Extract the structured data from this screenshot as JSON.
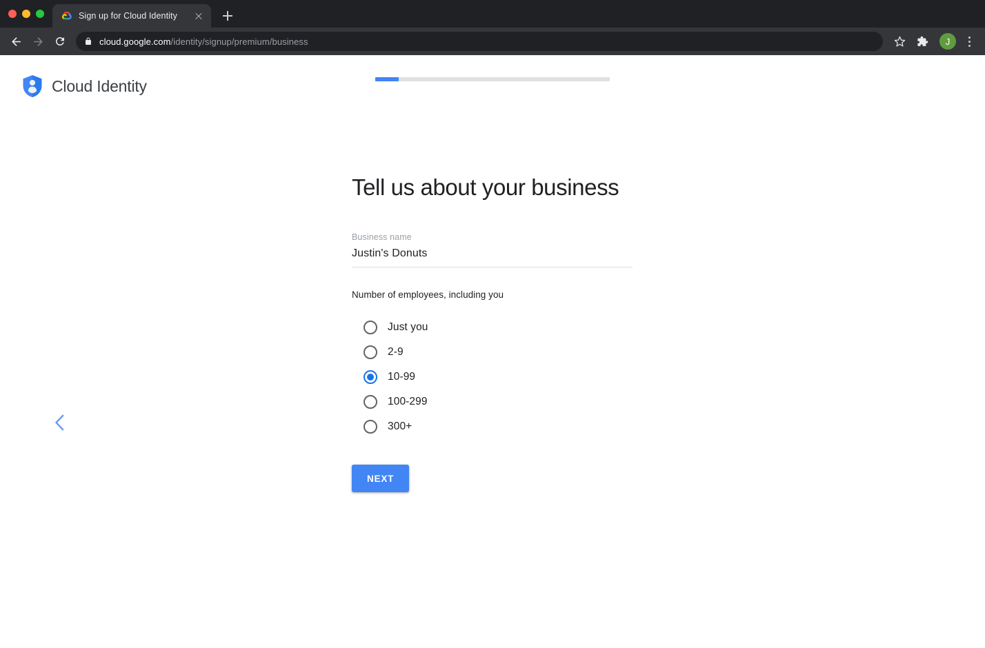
{
  "browser": {
    "window_controls": [
      "close",
      "minimize",
      "maximize"
    ],
    "tab": {
      "title": "Sign up for Cloud Identity",
      "favicon": "google-cloud-icon",
      "close_label": "×"
    },
    "new_tab_label": "+",
    "nav": {
      "back": "back-arrow-icon",
      "forward": "forward-arrow-icon",
      "reload": "reload-icon"
    },
    "omnibox": {
      "lock": "lock-icon",
      "host": "cloud.google.com",
      "path": "/identity/signup/premium/business"
    },
    "actions": {
      "bookmark": "star-icon",
      "extensions": "puzzle-piece-icon",
      "avatar_initial": "J",
      "menu": "three-dot-menu-icon"
    }
  },
  "page": {
    "brand": {
      "logo": "cloud-identity-shield-icon",
      "name": "Cloud Identity"
    },
    "progress": {
      "percent": 10,
      "fill_color": "#4285f4",
      "track_color": "#e0e0e0"
    },
    "back_chevron": "chevron-left-icon",
    "headline": "Tell us about your business",
    "business_name_field": {
      "label": "Business name",
      "value": "Justin's Donuts"
    },
    "employees": {
      "label": "Number of employees, including you",
      "selected": "10-99",
      "options": [
        {
          "label": "Just you",
          "selected": false
        },
        {
          "label": "2-9",
          "selected": false
        },
        {
          "label": "10-99",
          "selected": true
        },
        {
          "label": "100-299",
          "selected": false
        },
        {
          "label": "300+",
          "selected": false
        }
      ]
    },
    "next_button": "NEXT",
    "accent_color": "#4285f4"
  }
}
